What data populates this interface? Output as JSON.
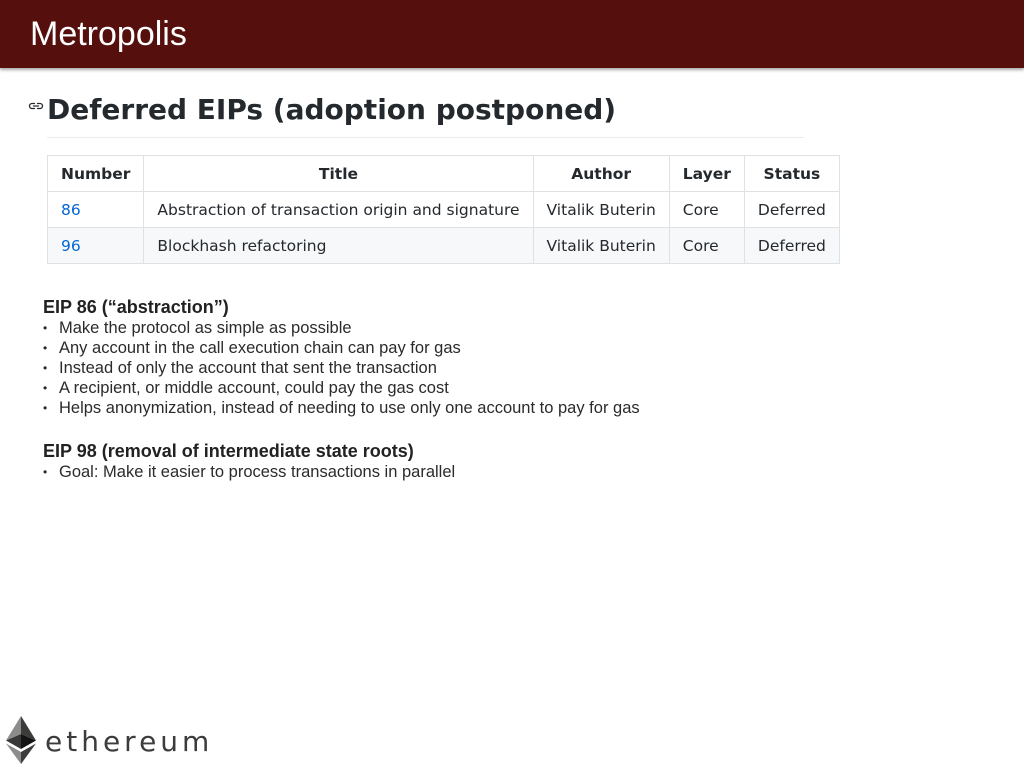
{
  "slide": {
    "title": "Metropolis"
  },
  "github": {
    "heading": "Deferred EIPs (adoption postponed)",
    "table": {
      "headers": [
        "Number",
        "Title",
        "Author",
        "Layer",
        "Status"
      ],
      "rows": [
        [
          "86",
          "Abstraction of transaction origin and signature",
          "Vitalik Buterin",
          "Core",
          "Deferred"
        ],
        [
          "96",
          "Blockhash refactoring",
          "Vitalik Buterin",
          "Core",
          "Deferred"
        ]
      ]
    }
  },
  "notes": {
    "sections": [
      {
        "heading": "EIP 86 (“abstraction”)",
        "bullets": [
          "Make the protocol as simple as possible",
          "Any account in the call execution chain can pay for gas",
          "Instead of only the account that sent the transaction",
          "A recipient, or middle account, could pay the gas cost",
          "Helps anonymization, instead of needing to use only one account to pay for gas"
        ]
      },
      {
        "heading": "EIP 98 (removal of intermediate state roots)",
        "bullets": [
          "Goal: Make it easier to process transactions in parallel"
        ]
      }
    ],
    "bullet_char": "•"
  },
  "logo": {
    "wordmark": "ethereum",
    "icon": "ethereum-diamond-icon"
  },
  "colors": {
    "title_bar": "#55100d",
    "link": "#0366d6",
    "table_border": "#dfe2e5",
    "table_alt_row": "#f6f8fa"
  }
}
